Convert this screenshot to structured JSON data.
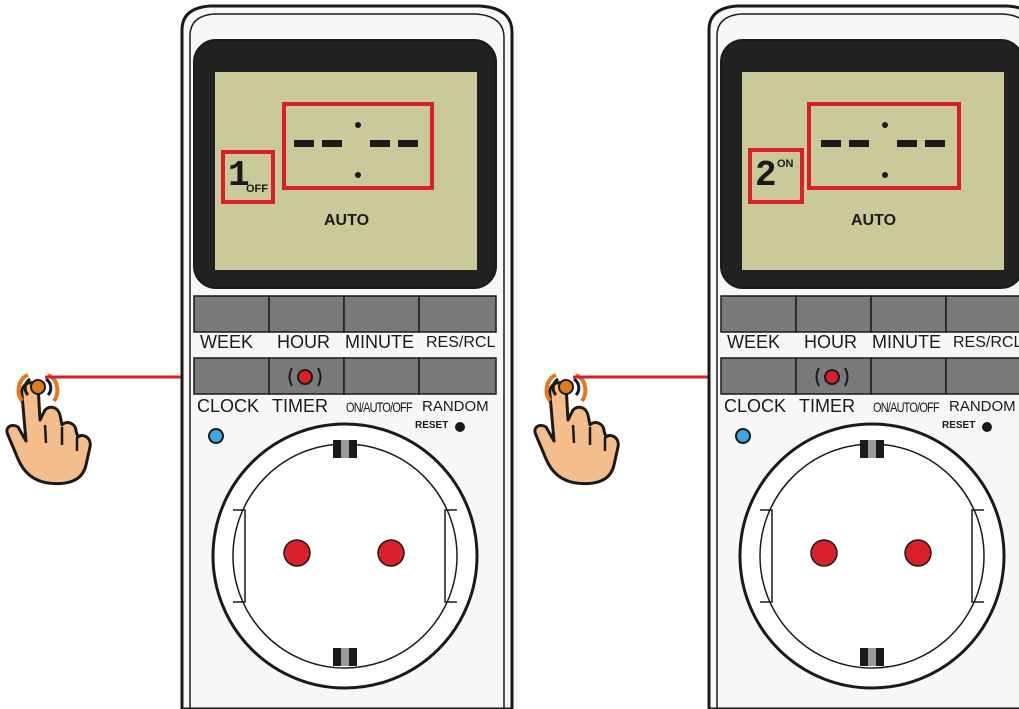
{
  "devices": [
    {
      "lcd": {
        "program_number": "1",
        "program_state": "OFF",
        "time_display": "--:--",
        "mode": "AUTO"
      },
      "buttons_top": [
        "WEEK",
        "HOUR",
        "MINUTE",
        "RES/RCL"
      ],
      "buttons_bottom": [
        "CLOCK",
        "TIMER",
        "ON/AUTO/OFF",
        "RANDOM"
      ],
      "reset_label": "RESET"
    },
    {
      "lcd": {
        "program_number": "2",
        "program_state": "ON",
        "time_display": "--:--",
        "mode": "AUTO"
      },
      "buttons_top": [
        "WEEK",
        "HOUR",
        "MINUTE",
        "RES/RCL"
      ],
      "buttons_bottom": [
        "CLOCK",
        "TIMER",
        "ON/AUTO/OFF",
        "RANDOM"
      ],
      "reset_label": "RESET"
    }
  ],
  "colors": {
    "lcd_background": "#c9c99a",
    "highlight": "#d9202a",
    "button_gray": "#7a7a7a",
    "hand_skin": "#f4be8c",
    "led_blue": "#3aa7e0"
  },
  "icons": {
    "press_indicator": "hand-pointer-icon",
    "led": "blue-led-icon"
  }
}
